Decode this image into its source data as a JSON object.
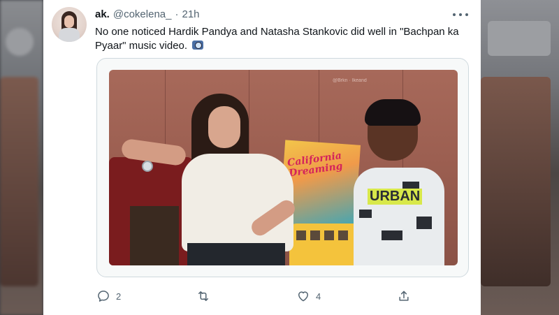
{
  "tweet": {
    "display_name": "ak.",
    "handle": "@cokelena_",
    "separator": "·",
    "timestamp": "21h",
    "text": "No one noticed Hardik Pandya and Natasha Stankovic did well in \"Bachpan ka Pyaar\" music video.",
    "emoji": "camera-with-flash-emoji",
    "media": {
      "watermark": "@Brkn · Ikeand",
      "poster_text": "California Dreaming",
      "shirt_print": "URBAN"
    }
  },
  "actions": {
    "reply_count": "2",
    "retweet_count": "",
    "like_count": "4",
    "share_count": ""
  },
  "colors": {
    "text_primary": "#0f1419",
    "text_secondary": "#536471",
    "border": "#cfd9de",
    "background": "#ffffff"
  }
}
